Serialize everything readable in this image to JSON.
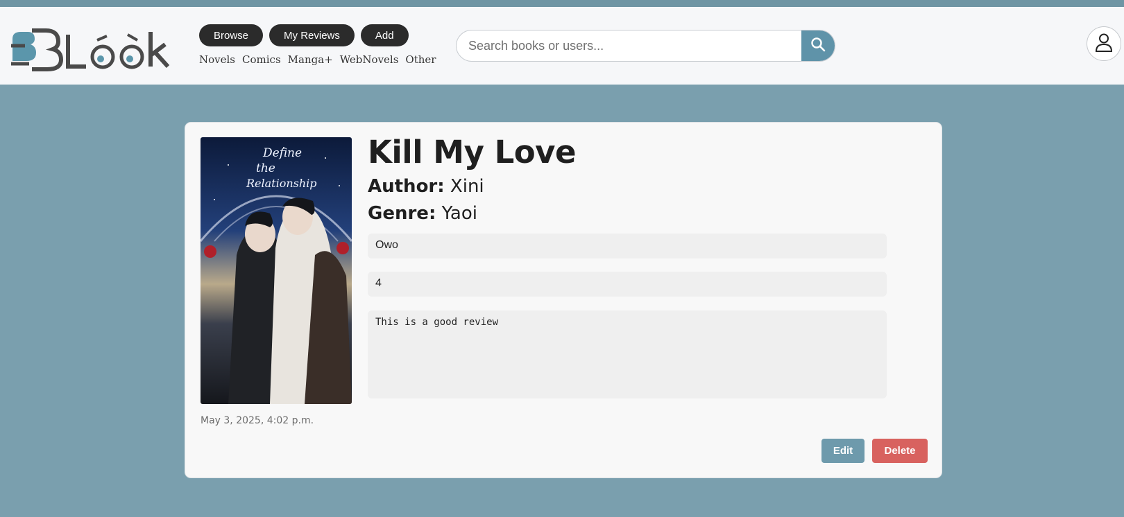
{
  "header": {
    "nav_buttons": [
      "Browse",
      "My Reviews",
      "Add"
    ],
    "categories": [
      "Novels",
      "Comics",
      "Manga+",
      "WebNovels",
      "Other"
    ],
    "search": {
      "placeholder": "Search books or users...",
      "value": ""
    },
    "icons": {
      "search": "search-icon",
      "profile": "user-profile-icon",
      "logo": "bblook-logo"
    }
  },
  "review": {
    "book_title": "Kill My Love",
    "author_label": "Author:",
    "author": "Xini",
    "genre_label": "Genre:",
    "genre": "Yaoi",
    "review_title": "Owo",
    "rating": "4",
    "review_text": "This is a good review",
    "date": "May 3, 2025, 4:02 p.m.",
    "cover_text": "Define the Relationship"
  },
  "actions": {
    "edit": "Edit",
    "delete": "Delete"
  },
  "colors": {
    "page_bg": "#7a9fae",
    "header_bg": "#f6f7f9",
    "pill_bg": "#2b2b2b",
    "search_btn": "#5f93a9",
    "edit_btn": "#6e9aac",
    "delete_btn": "#d8625f"
  }
}
